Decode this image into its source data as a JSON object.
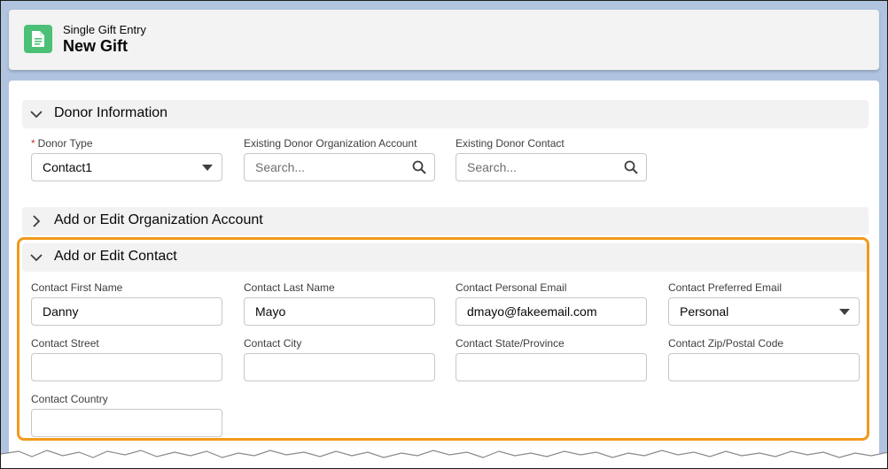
{
  "header": {
    "subtitle": "Single Gift Entry",
    "title": "New Gift",
    "icon": "document-icon",
    "accent_color": "#4bc076"
  },
  "donor_section": {
    "title": "Donor Information",
    "donor_type": {
      "label": "Donor Type",
      "value": "Contact1"
    },
    "org_account": {
      "label": "Existing Donor Organization Account",
      "placeholder": "Search..."
    },
    "donor_contact": {
      "label": "Existing Donor Contact",
      "placeholder": "Search..."
    }
  },
  "org_section": {
    "title": "Add or Edit Organization Account"
  },
  "contact_section": {
    "title": "Add or Edit Contact",
    "highlight_color": "#f09a1d",
    "first_name": {
      "label": "Contact First Name",
      "value": "Danny"
    },
    "last_name": {
      "label": "Contact Last Name",
      "value": "Mayo"
    },
    "personal_email": {
      "label": "Contact Personal Email",
      "value": "dmayo@fakeemail.com"
    },
    "preferred_email": {
      "label": "Contact Preferred Email",
      "value": "Personal"
    },
    "street": {
      "label": "Contact Street",
      "value": ""
    },
    "city": {
      "label": "Contact City",
      "value": ""
    },
    "state": {
      "label": "Contact State/Province",
      "value": ""
    },
    "zip": {
      "label": "Contact Zip/Postal Code",
      "value": ""
    },
    "country": {
      "label": "Contact Country",
      "value": ""
    }
  }
}
